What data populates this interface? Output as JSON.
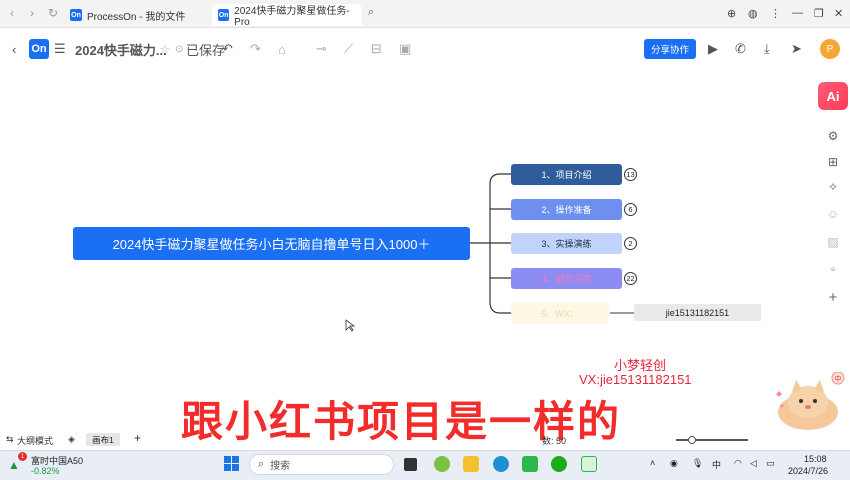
{
  "browser": {
    "tabs": [
      {
        "title": "ProcessOn - 我的文件",
        "favicon": "On"
      },
      {
        "title": "2024快手磁力聚星做任务-Pro",
        "favicon": "On"
      }
    ]
  },
  "toolbar": {
    "logo": "On",
    "doc_title": "2024快手磁力...",
    "saved_status": "已保存",
    "share_label": "分享协作",
    "avatar_letter": "P"
  },
  "sidebar": {
    "ai_label": "Ai"
  },
  "mindmap": {
    "root": "2024快手磁力聚星做任务小白无脑自撸单号日入1000＋",
    "children": [
      {
        "label": "1、项目介绍",
        "badge": "13",
        "bg": "#2f5d9c",
        "color": "#ffffff"
      },
      {
        "label": "2、操作准备",
        "badge": "6",
        "bg": "#6d8ff0",
        "color": "#ffffff"
      },
      {
        "label": "3、实操演练",
        "badge": "2",
        "bg": "#c0d3fb",
        "color": "#1f2b4a"
      },
      {
        "label": "4、细节深究",
        "badge": "22",
        "bg": "#8c8cf2",
        "color": "#f07cb6"
      },
      {
        "label": "5、WX：",
        "badge": "",
        "bg": "#fdf7e4",
        "color": "#e7d9a8"
      }
    ],
    "wx_value": "jie15131182151"
  },
  "watermark": {
    "line1": "小梦轻创",
    "line2": "VX:jie15131182151"
  },
  "subtitle": "跟小红书项目是一样的",
  "bottom_bar": {
    "outline_mode": "大纲模式",
    "canvas_tab": "画布1",
    "count_label": "数: 50"
  },
  "taskbar": {
    "stock_name": "富时中国A50",
    "stock_change": "-0.82%",
    "stock_badge": "1",
    "search_placeholder": "搜索",
    "ime": "中",
    "time": "15:08",
    "date": "2024/7/26"
  }
}
